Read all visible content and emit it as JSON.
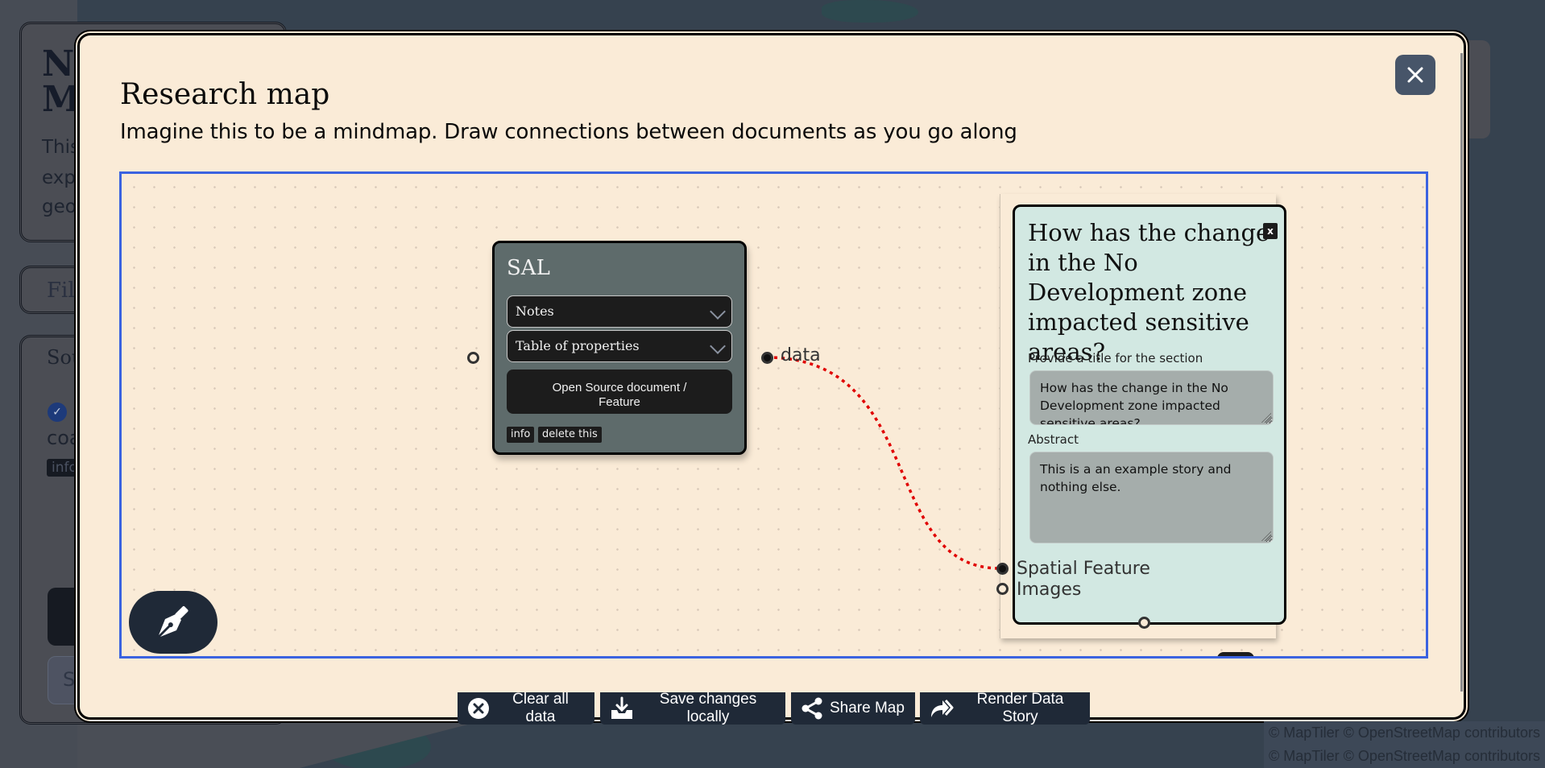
{
  "background": {
    "sidebar": {
      "title_lines": [
        "Na",
        "M"
      ],
      "desc_lines": [
        "This",
        "exp",
        "geo"
      ],
      "filter_placeholder": "Filt",
      "sources_heading": "Sou",
      "source_item": "coa",
      "info_tag": "info",
      "search_button": "S"
    },
    "attribution": [
      "© MapTiler © OpenStreetMap contributors",
      "© MapTiler © OpenStreetMap contributors"
    ]
  },
  "modal": {
    "title": "Research map",
    "subtitle": "Imagine this to be a mindmap. Draw connections between documents as you go along",
    "close_icon": "close-icon",
    "canvas": {
      "source_node": {
        "title": "SAL",
        "notes_label": "Notes",
        "table_label": "Table of properties",
        "open_button": "Open Source document / Feature",
        "tags": [
          "info",
          "delete this"
        ],
        "output_handle_label": "data"
      },
      "story_node": {
        "heading": "How has the change in the No Development zone impacted sensitive areas?",
        "close_label": "x",
        "title_field_label": "Provide a title for the section",
        "title_field_value": "How has the change in the No Development zone impacted sensitive areas?",
        "abstract_label": "Abstract",
        "abstract_value": "This is  a an example story and nothing else.",
        "input_handles": [
          "Spatial Feature",
          "Images"
        ]
      },
      "edge": {
        "from": "data",
        "to": "Spatial Feature",
        "color": "#e00000",
        "style": "dotted"
      },
      "draw_tool_icon": "pen-nib-icon"
    },
    "toolbar": [
      {
        "label": "Clear all data",
        "icon": "circle-x-icon"
      },
      {
        "label": "Save changes locally",
        "icon": "download-tray-icon"
      },
      {
        "label": "Share Map",
        "icon": "share-icon"
      },
      {
        "label": "Render Data Story",
        "icon": "forward-arrows-icon"
      }
    ]
  },
  "colors": {
    "modal_bg": "#faebd7",
    "canvas_border": "#3b63e0",
    "dark_button": "#1f2937",
    "close_button": "#475569",
    "source_node_bg": "#5e6b6b",
    "story_node_bg": "#d2e8e2"
  }
}
